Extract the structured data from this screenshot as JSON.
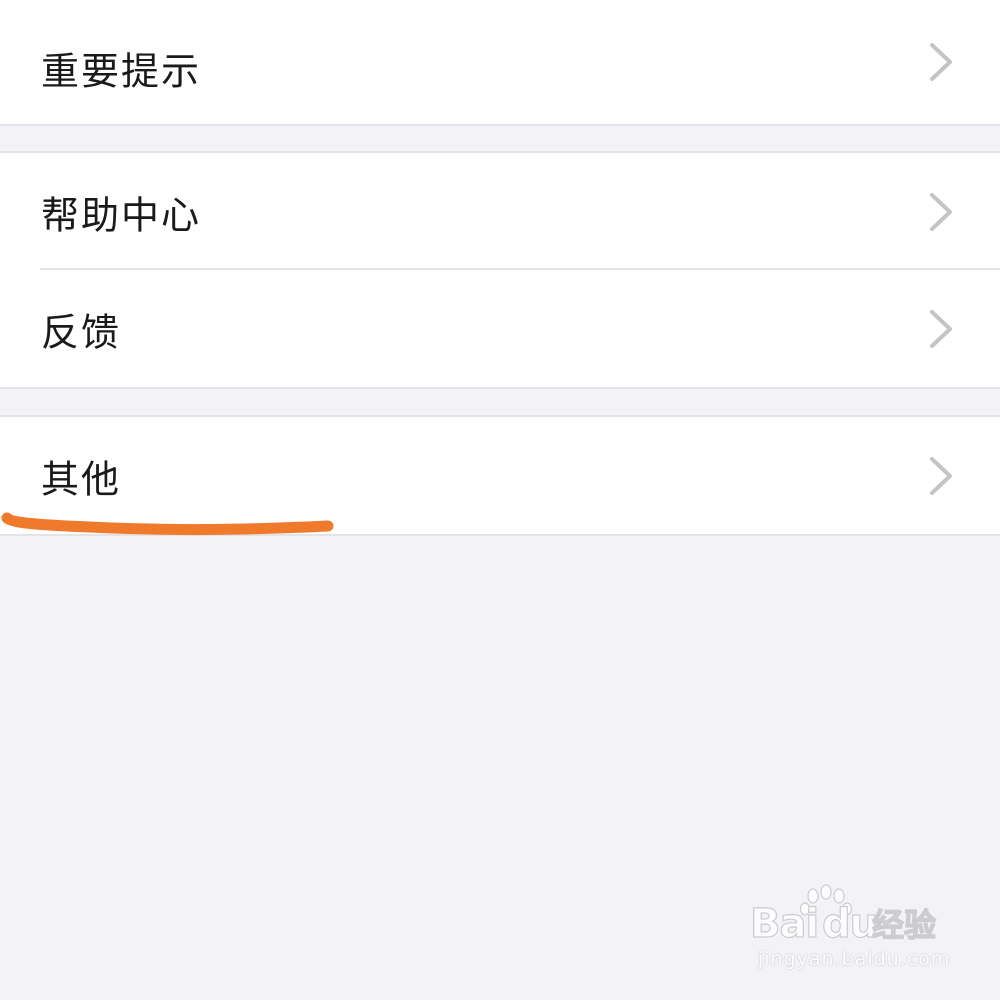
{
  "settings": {
    "groups": [
      {
        "items": [
          {
            "label": "重要提示",
            "icon": "chevron-right-icon"
          }
        ]
      },
      {
        "items": [
          {
            "label": "帮助中心",
            "icon": "chevron-right-icon"
          },
          {
            "label": "反馈",
            "icon": "chevron-right-icon"
          }
        ]
      },
      {
        "items": [
          {
            "label": "其他",
            "icon": "chevron-right-icon",
            "annotated": true
          }
        ]
      }
    ]
  },
  "annotation": {
    "type": "hand-drawn-underline",
    "color": "#f07a2c",
    "target": "其他"
  },
  "watermark": {
    "logo_text": "Baidu经验",
    "url": "jingyan.baidu.com"
  },
  "colors": {
    "background": "#f2f2f7",
    "row_background": "#ffffff",
    "separator": "#e4e4e8",
    "chevron": "#c4c4c7",
    "text": "#1a1a1a"
  }
}
